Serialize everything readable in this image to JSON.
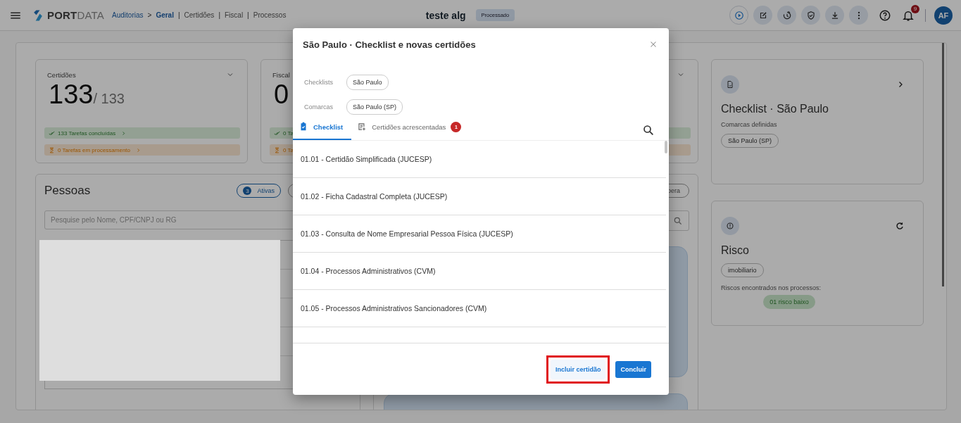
{
  "top_bar": {
    "logo": {
      "bold": "PORT",
      "light": "DATA"
    },
    "breadcrumb": [
      {
        "label": "Auditorias",
        "kind": "link"
      },
      {
        "label": ">",
        "kind": "separator"
      },
      {
        "label": "Geral",
        "kind": "current"
      },
      {
        "label": "|",
        "kind": "separator"
      },
      {
        "label": "Certidões",
        "kind": "section"
      },
      {
        "label": "|",
        "kind": "separator"
      },
      {
        "label": "Fiscal",
        "kind": "section"
      },
      {
        "label": "|",
        "kind": "separator"
      },
      {
        "label": "Processos",
        "kind": "section"
      }
    ],
    "title": "teste alg",
    "status": "Processado",
    "notifications": "9",
    "avatar": "AF"
  },
  "summary_cards": [
    {
      "label": "Certidões",
      "value": "133",
      "total": "/ 133",
      "done": "133 Tarefas concluídas",
      "processing": "0 Tarefas em processamento"
    },
    {
      "label": "Fiscal",
      "value": "0",
      "done": "0 Ta",
      "processing": "0 Ta"
    }
  ],
  "pessoas": {
    "title": "Pessoas",
    "filter": {
      "count": "3",
      "label": "Ativas"
    },
    "search": {
      "placeholder": "Pesquise pelo Nome, CPF/CNPJ ou RG"
    }
  },
  "second_panel": {
    "filter": "pera"
  },
  "checklist_card": {
    "title": "Checklist · São Paulo",
    "subtitle": "Comarcas definidas",
    "chips": [
      "São Paulo (SP)"
    ]
  },
  "risk_card": {
    "title": "Risco",
    "chips": [
      "imobiliario"
    ],
    "subtitle": "Riscos encontrados nos processos:",
    "risks": [
      {
        "label": "01 risco baixo"
      }
    ]
  },
  "modal": {
    "title": "São Paulo · Checklist e novas certidões",
    "filters": [
      {
        "label": "Checklists",
        "chips": [
          "São Paulo"
        ]
      },
      {
        "label": "Comarcas",
        "chips": [
          "São Paulo (SP)"
        ]
      }
    ],
    "tabs": [
      {
        "label": "Checklist",
        "selected": true
      },
      {
        "label": "Certidões acrescentadas",
        "selected": false,
        "badge": "1"
      }
    ],
    "items": [
      "01.01 - Certidão Simplificada (JUCESP)",
      "01.02 - Ficha Cadastral Completa (JUCESP)",
      "01.03 - Consulta de Nome Empresarial Pessoa Física (JUCESP)",
      "01.04 - Processos Administrativos (CVM)",
      "01.05 - Processos Administrativos Sancionadores (CVM)"
    ],
    "buttons": [
      {
        "label": "Incluir certidão",
        "kind": "text",
        "highlighted": true
      },
      {
        "label": "Concluir",
        "kind": "primary",
        "highlighted": false
      }
    ]
  }
}
